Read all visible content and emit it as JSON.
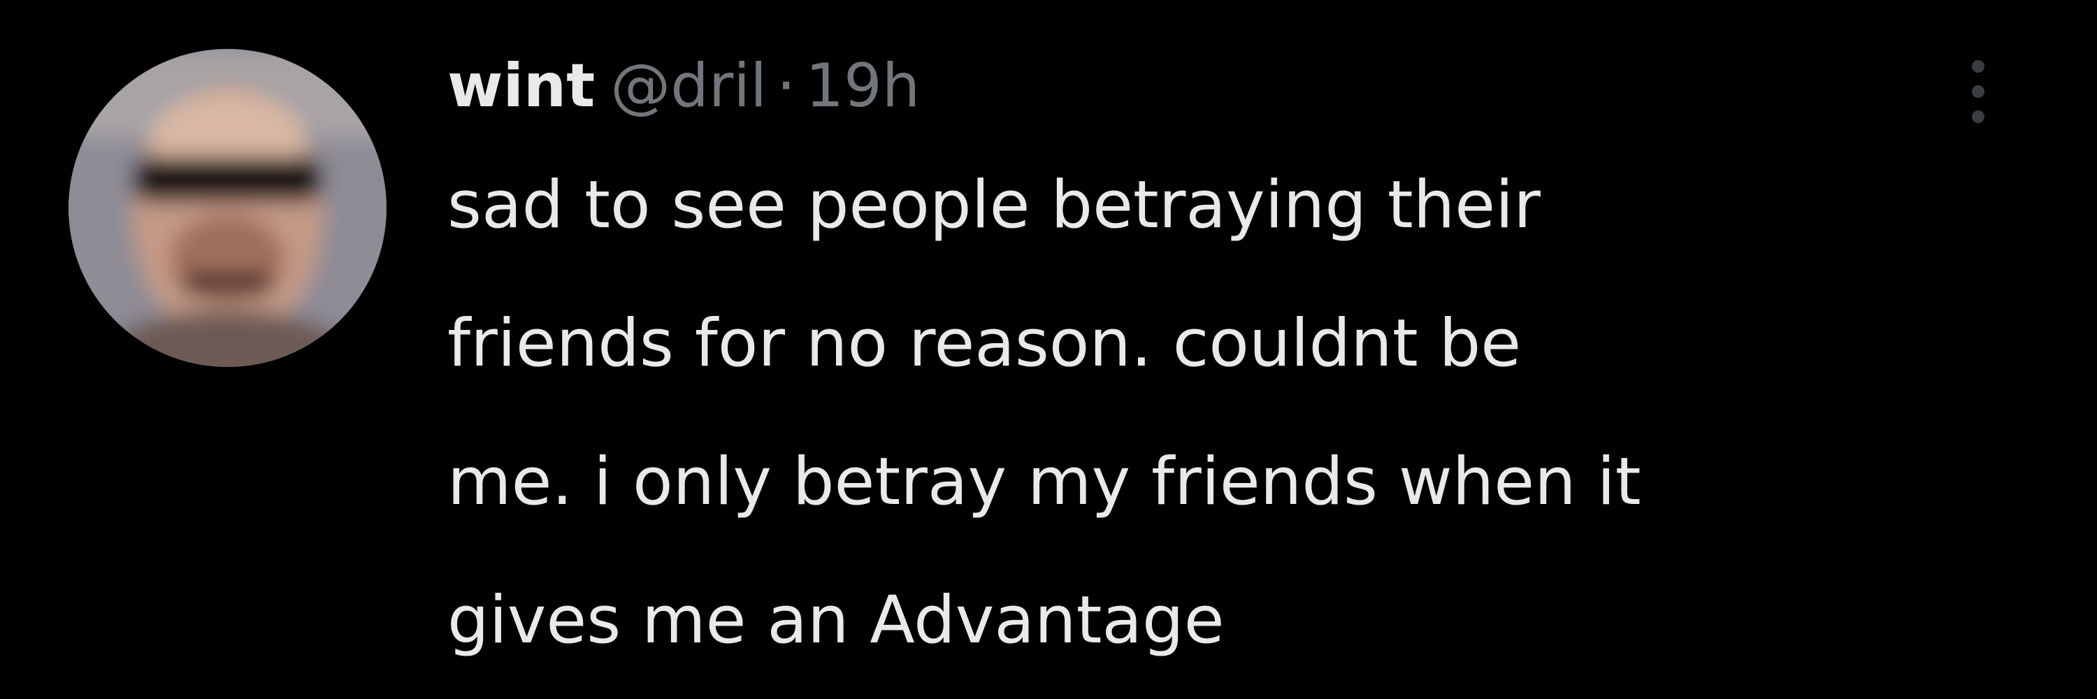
{
  "tweet": {
    "display_name": "wint",
    "handle": "@dril",
    "separator": "·",
    "timestamp": "19h",
    "more_icon": "more-dots-icon",
    "text_lines": [
      "sad to see people betraying their",
      "friends for no reason. couldnt be",
      "me. i only betray my friends when it",
      "gives me an Advantage"
    ],
    "colors": {
      "background": "#000000",
      "primary_text": "#e7e9ea",
      "secondary_text": "#71767b"
    }
  }
}
